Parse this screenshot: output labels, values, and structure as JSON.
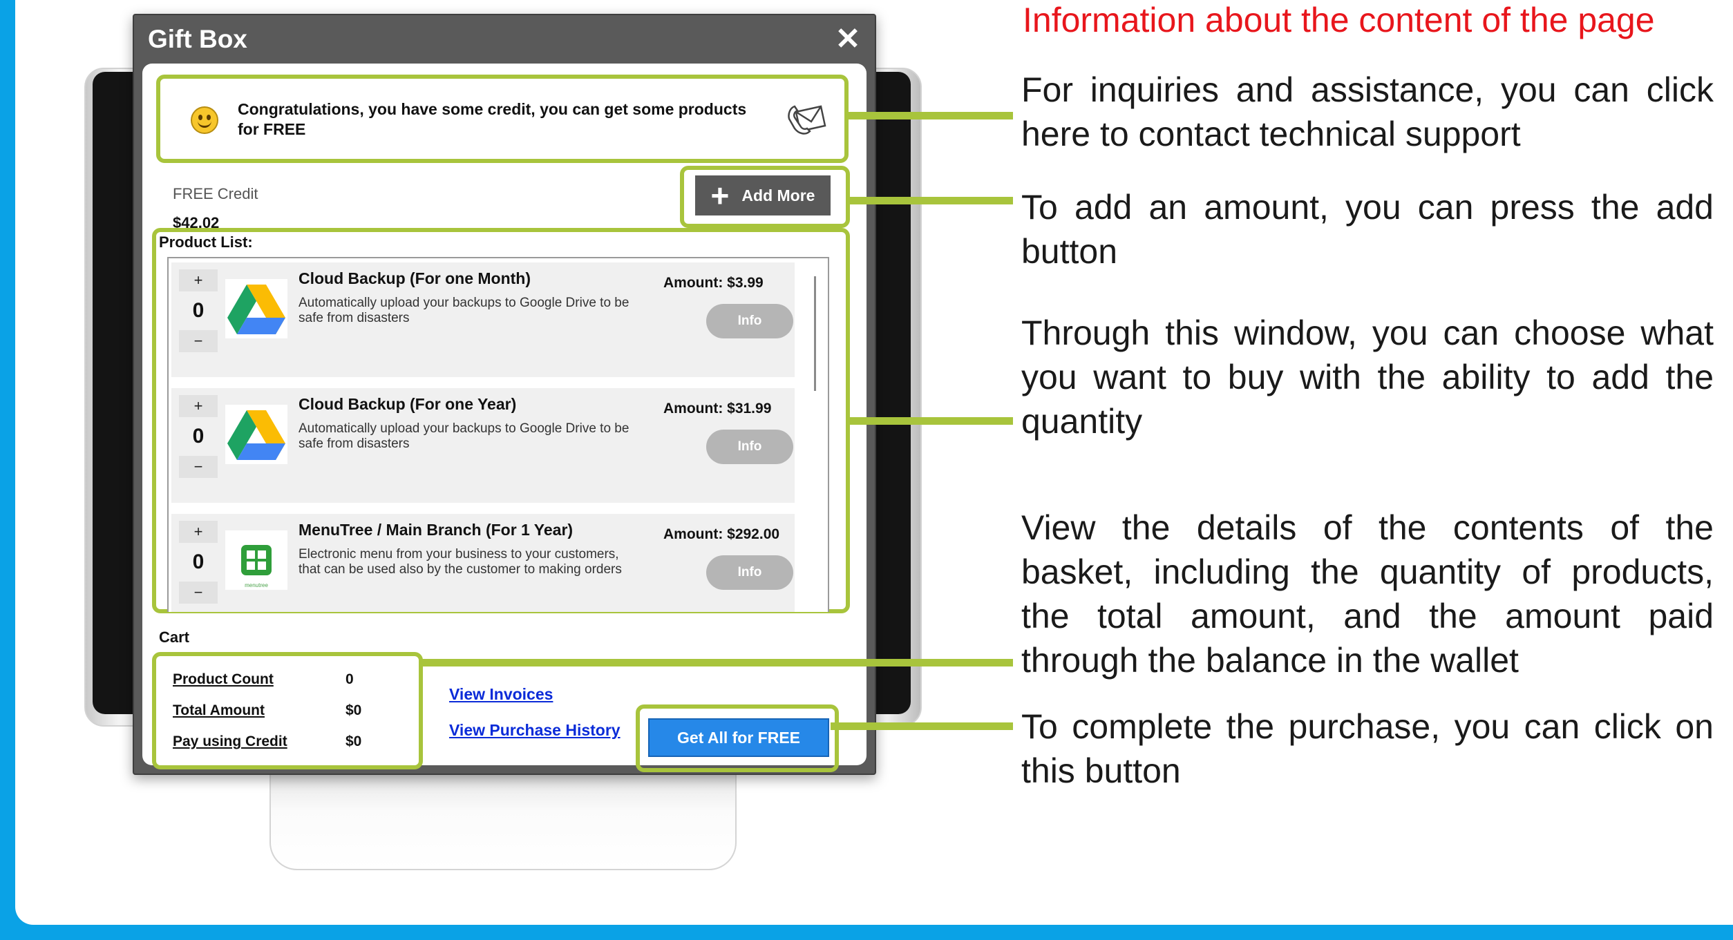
{
  "dialog": {
    "title": "Gift Box",
    "close_label": "✕",
    "notice": "Congratulations, you have some credit, you can get some products for FREE",
    "credit_label": "FREE Credit",
    "credit_value": "$42.02",
    "add_more_label": "Add More",
    "product_list_label": "Product List:",
    "products": [
      {
        "name": "Cloud Backup (For one Month)",
        "description": "Automatically upload your backups to Google Drive to be safe from disasters",
        "amount": "Amount: $3.99",
        "qty": "0",
        "plus": "+",
        "minus": "−",
        "info": "Info"
      },
      {
        "name": "Cloud Backup (For one Year)",
        "description": "Automatically upload your backups to Google Drive to be safe from disasters",
        "amount": "Amount: $31.99",
        "qty": "0",
        "plus": "+",
        "minus": "−",
        "info": "Info"
      },
      {
        "name": "MenuTree / Main Branch (For 1 Year)",
        "description": "Electronic menu from your business to your customers, that can be used also by the customer to making orders",
        "amount": "Amount: $292.00",
        "qty": "0",
        "plus": "+",
        "minus": "−",
        "info": "Info",
        "logo_caption": "menutree"
      }
    ],
    "cart_label": "Cart",
    "cart": [
      {
        "label": "Product Count",
        "value": "0"
      },
      {
        "label": "Total Amount",
        "value": "$0"
      },
      {
        "label": "Pay using Credit",
        "value": "$0"
      }
    ],
    "view_invoices": "View Invoices",
    "view_purchase_history": "View Purchase History",
    "get_all_label": "Get All for FREE"
  },
  "icons": {
    "notice": "smile-icon",
    "support": "mail-icon",
    "add": "plus-icon",
    "product_backup": "google-drive-icon",
    "product_menu": "menutree-icon"
  },
  "colors": {
    "highlight": "#a8c43c",
    "title_red": "#e8161c",
    "frame_blue": "#0aa2e6",
    "button_blue": "#2688e8"
  },
  "info": {
    "title": "Information about the content of the page",
    "annotations": [
      "For inquiries and assistance, you can click here to contact technical support",
      "To add an amount, you can press the add button",
      "Through this window, you can choose what you want to buy with the ability to add the quantity",
      "View the details of the contents of the basket, including the quantity of products, the total amount, and the amount paid through the balance in the wallet",
      "To complete the purchase, you can click on this button"
    ]
  }
}
